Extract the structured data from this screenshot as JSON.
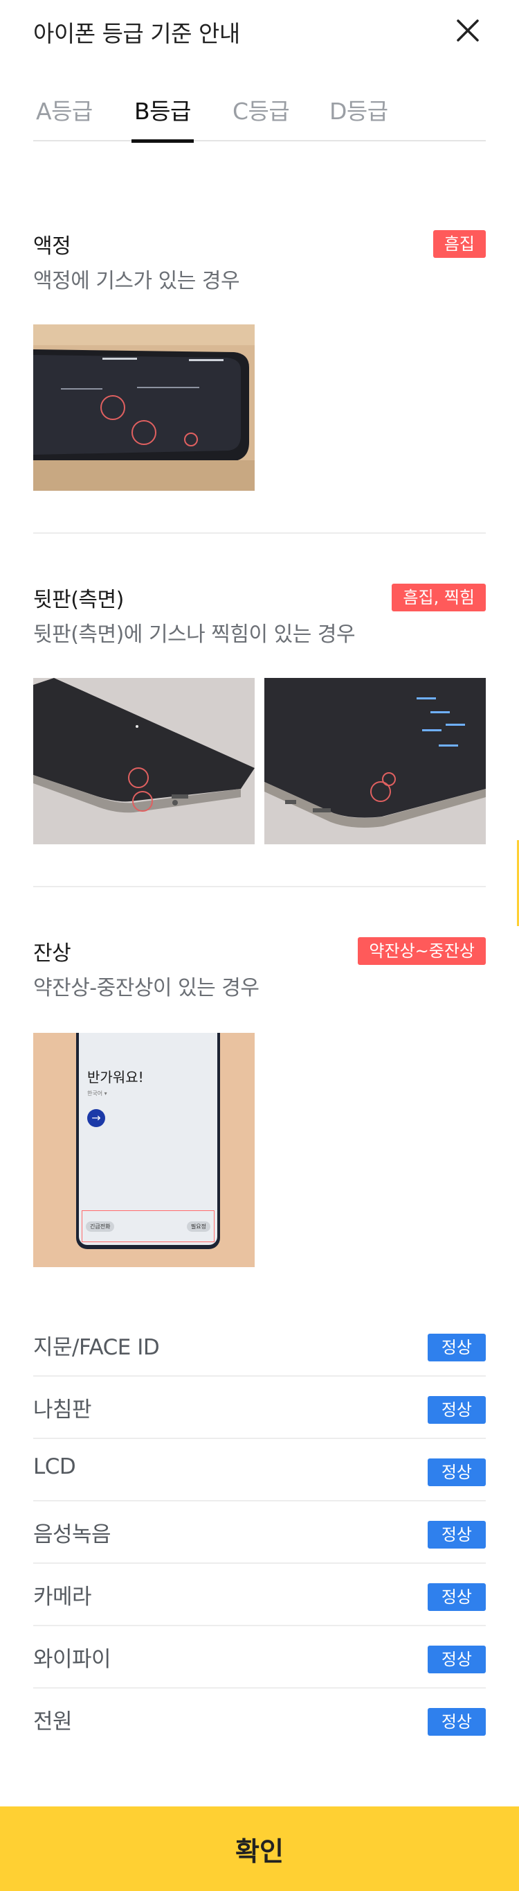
{
  "header": {
    "title": "아이폰 등급 기준 안내"
  },
  "tabs": [
    {
      "label": "A등급",
      "active": false
    },
    {
      "label": "B등급",
      "active": true
    },
    {
      "label": "C등급",
      "active": false
    },
    {
      "label": "D등급",
      "active": false
    }
  ],
  "sections": [
    {
      "title": "액정",
      "badge": "흠집",
      "description": "액정에 기스가 있는 경우"
    },
    {
      "title": "뒷판(측면)",
      "badge": "흠집, 찍힘",
      "description": "뒷판(측면)에 기스나 찍힘이 있는 경우"
    },
    {
      "title": "잔상",
      "badge": "약잔상~중잔상",
      "description": "약잔상-중잔상이 있는 경우"
    }
  ],
  "phone_screen": {
    "greeting": "반가워요!",
    "language": "한국어 ▾",
    "left_button": "긴급전화",
    "right_button": "필요정"
  },
  "status_list": [
    {
      "label": "지문/FACE ID",
      "status": "정상"
    },
    {
      "label": "나침판",
      "status": "정상"
    },
    {
      "label": "LCD",
      "status": "정상"
    },
    {
      "label": "음성녹음",
      "status": "정상"
    },
    {
      "label": "카메라",
      "status": "정상"
    },
    {
      "label": "와이파이",
      "status": "정상"
    },
    {
      "label": "전원",
      "status": "정상"
    }
  ],
  "confirm_button": {
    "label": "확인"
  },
  "colors": {
    "accent_yellow": "#ffd033",
    "badge_red": "#ff5a5a",
    "badge_blue": "#2f80ed"
  }
}
